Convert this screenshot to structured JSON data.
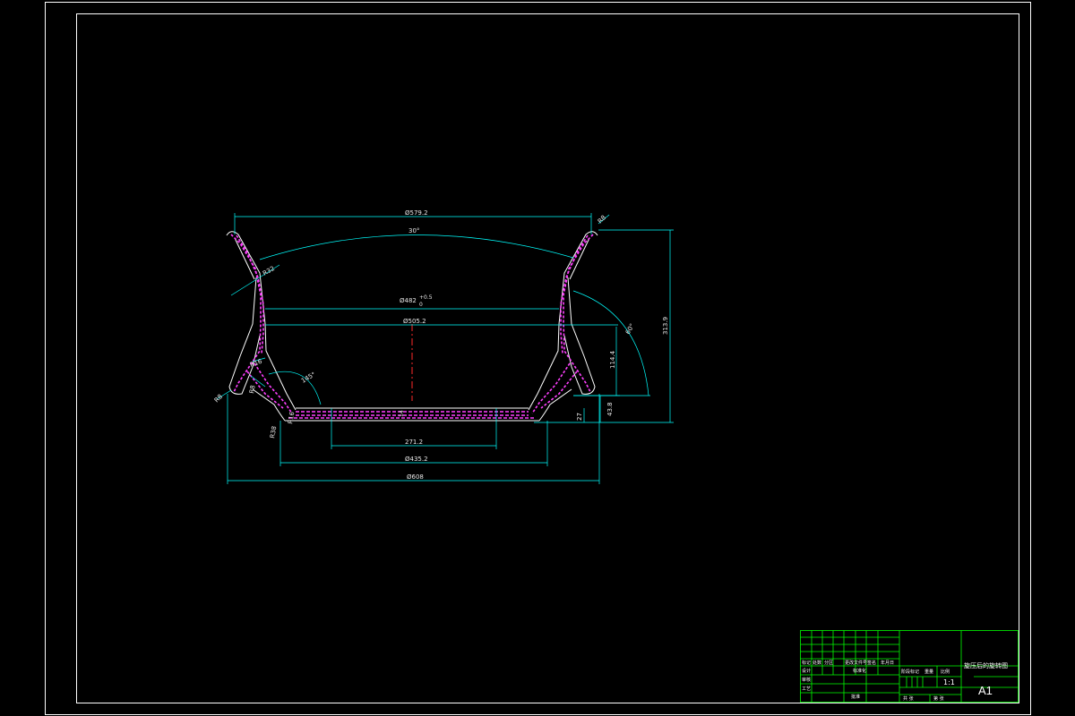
{
  "colors": {
    "background": "#000000",
    "frame": "#ffffff",
    "outline": "#ffffff",
    "hatch": "#ff40ff",
    "dimension": "#00ffff",
    "dim_text": "#e8e8e8",
    "centerline": "#ff2a2a",
    "titleblock": "#00ff00"
  },
  "dimensions": {
    "top_width": "Ø579.2",
    "flange_angle": "30°",
    "bead_seat": "Ø482",
    "bead_tol_upper": "+0.5",
    "bead_tol_lower": "0",
    "inner_width": "Ø505.2",
    "well_width": "271.2",
    "base_width": "Ø435.2",
    "overall_width": "Ø608",
    "overall_height": "313.9",
    "height_mid": "114.4",
    "height_low": "43.8",
    "height_small": "27",
    "radius_top": "R8",
    "radius_left": "R32",
    "side_angle": "60°",
    "inner_angle": "145°",
    "r_a": "R8",
    "r_b": "R16",
    "r_c": "R8",
    "r_d": "R38",
    "r_e": "R16",
    "center_mark": "14"
  },
  "title_block": {
    "drawing_name": "旋压后的旋转图",
    "scale_label": "比例",
    "scale_value": "1:1",
    "sheet_size": "A1",
    "sheet_label": "共 张",
    "sheet_of": "第 张",
    "header_cells": [
      "标记",
      "处数",
      "分区",
      "更改文件号",
      "签名",
      "年月日"
    ],
    "rows": [
      "设计",
      "审核",
      "工艺"
    ],
    "standardization": "标准化",
    "approve": "批准",
    "stage_labels": [
      "阶段标记",
      "重量",
      "比例"
    ]
  }
}
